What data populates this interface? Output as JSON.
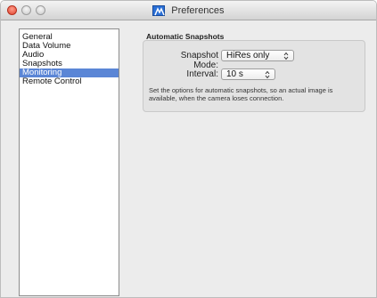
{
  "window": {
    "title": "Preferences",
    "app_icon": "brand-logo-icon"
  },
  "sidebar": {
    "items": [
      {
        "label": "General",
        "selected": false
      },
      {
        "label": "Data Volume",
        "selected": false
      },
      {
        "label": "Audio",
        "selected": false
      },
      {
        "label": "Snapshots",
        "selected": false
      },
      {
        "label": "Monitoring",
        "selected": true
      },
      {
        "label": "Remote Control",
        "selected": false
      }
    ]
  },
  "main": {
    "group_title": "Automatic Snapshots",
    "snapshot_mode": {
      "label": "Snapshot Mode:",
      "value": "HiRes only"
    },
    "interval": {
      "label": "Interval:",
      "value": "10 s"
    },
    "description": "Set the options for automatic snapshots, so an actual image is available, when the camera loses connection."
  },
  "colors": {
    "selection": "#5b86d6",
    "close_button": "#e0442f"
  }
}
